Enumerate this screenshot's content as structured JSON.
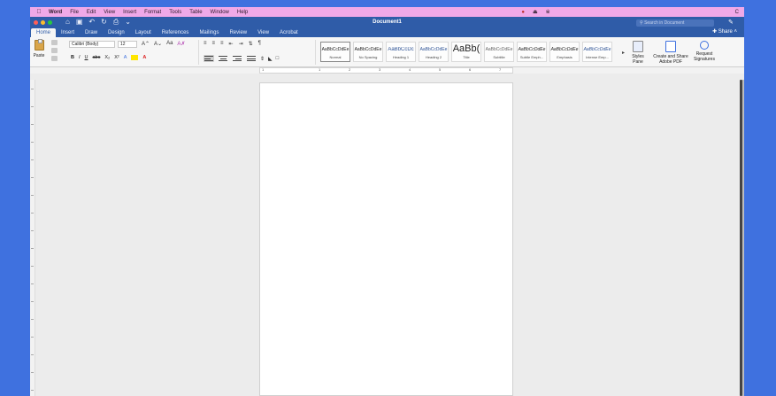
{
  "menubar": {
    "app": "Word",
    "items": [
      "File",
      "Edit",
      "View",
      "Insert",
      "Format",
      "Tools",
      "Table",
      "Window",
      "Help"
    ],
    "right_letter": "C"
  },
  "window": {
    "title": "Document1",
    "search_placeholder": "Search in Document",
    "share": "Share"
  },
  "tabs": [
    "Home",
    "Insert",
    "Draw",
    "Design",
    "Layout",
    "References",
    "Mailings",
    "Review",
    "View",
    "Acrobat"
  ],
  "ribbon": {
    "paste": "Paste",
    "font_name": "Calibri (Body)",
    "font_size": "12",
    "format_buttons": [
      "B",
      "I",
      "U",
      "abc",
      "X₂",
      "X²"
    ],
    "styles": [
      {
        "preview": "AaBbCcDdEe",
        "name": "Normal"
      },
      {
        "preview": "AaBbCcDdEe",
        "name": "No Spacing"
      },
      {
        "preview": "AaBbCcDc",
        "name": "Heading 1"
      },
      {
        "preview": "AaBbCcDdEe",
        "name": "Heading 2"
      },
      {
        "preview": "AaBb(",
        "name": "Title"
      },
      {
        "preview": "AaBbCcDdEe",
        "name": "Subtitle"
      },
      {
        "preview": "AaBbCcDdEe",
        "name": "Subtle Emph..."
      },
      {
        "preview": "AaBbCcDdEe",
        "name": "Emphasis"
      },
      {
        "preview": "AaBbCcDdEe",
        "name": "Intense Emp..."
      }
    ],
    "styles_pane": "Styles Pane",
    "create_pdf": "Create and Share Adobe PDF",
    "request_signatures": "Request Signatures"
  },
  "ruler_numbers": [
    "1",
    "1",
    "2",
    "3",
    "4",
    "5",
    "6",
    "7"
  ],
  "colors": {
    "desktop": "#3f71df",
    "menubar": "#f0a9e8",
    "titlebar": "#2f5ca8",
    "ribbon": "#f6f6f6",
    "canvas": "#ececec"
  }
}
